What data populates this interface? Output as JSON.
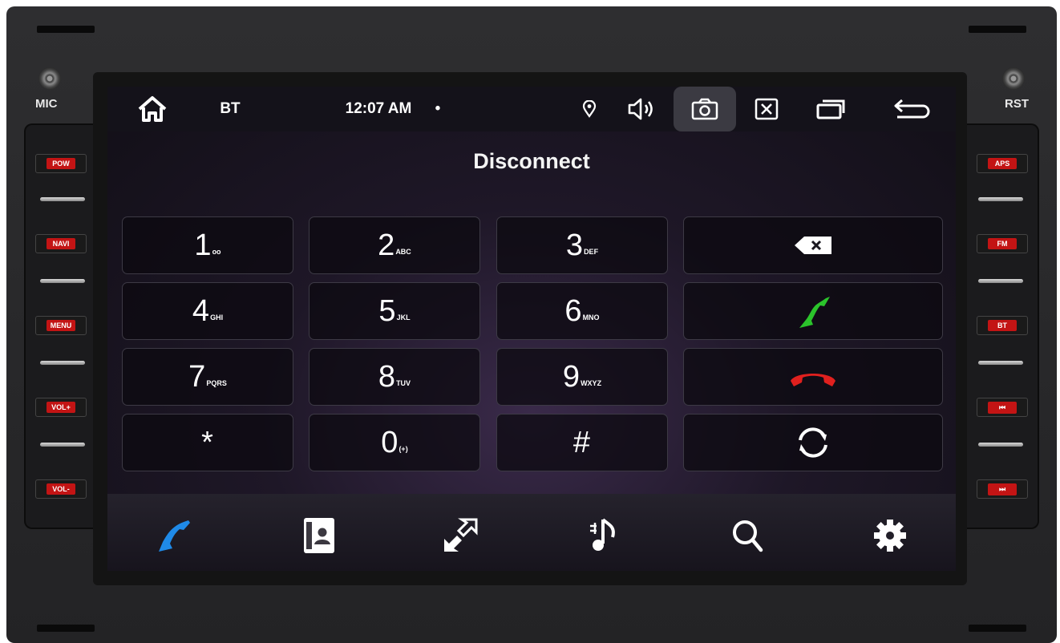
{
  "device": {
    "mic_label": "MIC",
    "rst_label": "RST"
  },
  "left_buttons": [
    "POW",
    "NAVI",
    "MENU",
    "VOL+",
    "VOL-"
  ],
  "right_buttons": [
    "APS",
    "FM",
    "BT",
    "⏮",
    "⏭"
  ],
  "statusbar": {
    "app_label": "BT",
    "time": "12:07 AM",
    "dot": "•"
  },
  "title": "Disconnect",
  "keypad": [
    {
      "digit": "1",
      "sub": "oo"
    },
    {
      "digit": "2",
      "sub": "ABC"
    },
    {
      "digit": "3",
      "sub": "DEF"
    },
    {
      "digit": "4",
      "sub": "GHI"
    },
    {
      "digit": "5",
      "sub": "JKL"
    },
    {
      "digit": "6",
      "sub": "MNO"
    },
    {
      "digit": "7",
      "sub": "PQRS"
    },
    {
      "digit": "8",
      "sub": "TUV"
    },
    {
      "digit": "9",
      "sub": "WXYZ"
    },
    {
      "digit": "*",
      "sub": ""
    },
    {
      "digit": "0",
      "sub": "(+)"
    },
    {
      "digit": "#",
      "sub": ""
    }
  ],
  "colors": {
    "call_green": "#2bc42b",
    "hangup_red": "#e0201e",
    "active_blue": "#1f8ae8",
    "hw_red": "#c31414"
  },
  "icons": {
    "statusbar": [
      "home-icon",
      "location-icon",
      "volume-icon",
      "screenshot-icon",
      "close-window-icon",
      "recent-apps-icon",
      "back-icon"
    ],
    "actions": [
      "backspace-icon",
      "call-icon",
      "hang-up-icon",
      "swap-icon"
    ],
    "bottom_nav": [
      "dial-icon",
      "contacts-icon",
      "transfer-icon",
      "music-icon",
      "search-icon",
      "settings-icon"
    ]
  }
}
